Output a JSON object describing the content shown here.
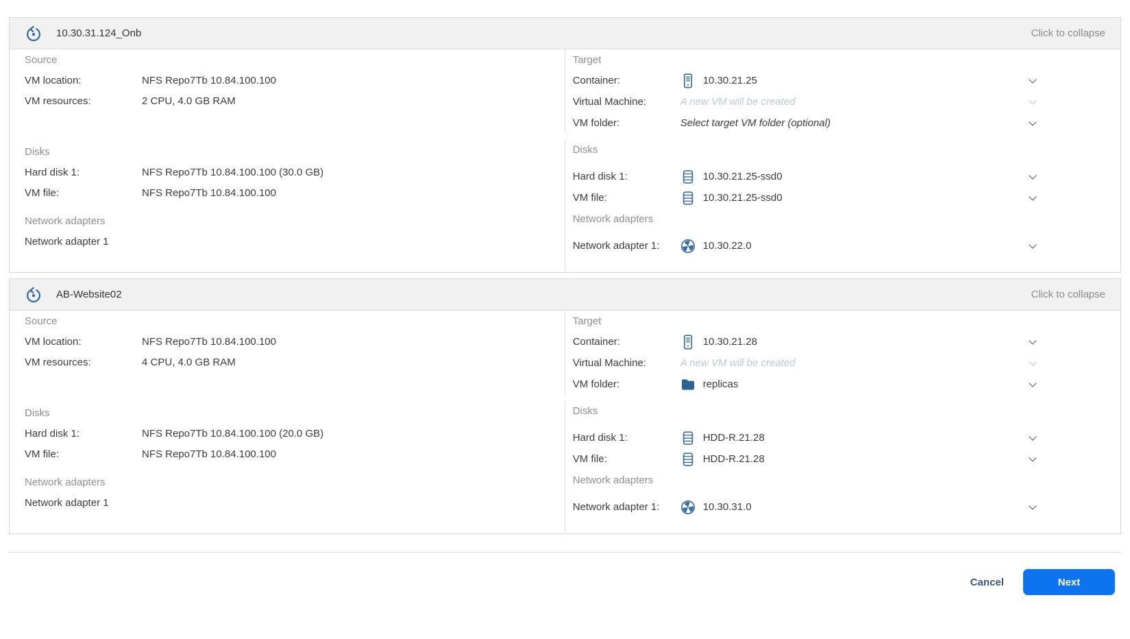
{
  "colors": {
    "accent_blue": "#0e73ee",
    "icon_blue": "#3a6d9e",
    "folder_blue": "#2d6496",
    "link_blue": "#33567d",
    "muted_text": "#8f8f8f",
    "placeholder_text": "#bcc8d4",
    "panel_header_bg": "#f1f1f1",
    "panel_border": "#d8d8d8"
  },
  "footer": {
    "cancel_label": "Cancel",
    "next_label": "Next"
  },
  "panels": [
    {
      "title": "10.30.31.124_Onb",
      "collapse_label": "Click to collapse",
      "source": {
        "heading": "Source",
        "vm_location_label": "VM location:",
        "vm_location_value": "NFS Repo7Tb 10.84.100.100",
        "vm_resources_label": "VM resources:",
        "vm_resources_value": "2 CPU, 4.0 GB RAM",
        "disks_heading": "Disks",
        "hard_disk_label": "Hard disk 1:",
        "hard_disk_value": "NFS Repo7Tb 10.84.100.100 (30.0 GB)",
        "vm_file_label": "VM file:",
        "vm_file_value": "NFS Repo7Tb 10.84.100.100",
        "network_heading": "Network adapters",
        "network_adapter_label": "Network adapter 1"
      },
      "target": {
        "heading": "Target",
        "container_label": "Container:",
        "container_value": "10.30.21.25",
        "vm_label": "Virtual Machine:",
        "vm_placeholder": "A new VM will be created",
        "vm_folder_label": "VM folder:",
        "vm_folder_value": "Select target VM folder (optional)",
        "disks_heading": "Disks",
        "hard_disk_label": "Hard disk 1:",
        "hard_disk_value": "10.30.21.25-ssd0",
        "vm_file_label": "VM file:",
        "vm_file_value": "10.30.21.25-ssd0",
        "network_heading": "Network adapters",
        "network_adapter_label": "Network adapter 1:",
        "network_adapter_value": "10.30.22.0"
      }
    },
    {
      "title": "AB-Website02",
      "collapse_label": "Click to collapse",
      "source": {
        "heading": "Source",
        "vm_location_label": "VM location:",
        "vm_location_value": "NFS Repo7Tb 10.84.100.100",
        "vm_resources_label": "VM resources:",
        "vm_resources_value": "4 CPU, 4.0 GB RAM",
        "disks_heading": "Disks",
        "hard_disk_label": "Hard disk 1:",
        "hard_disk_value": "NFS Repo7Tb 10.84.100.100 (20.0 GB)",
        "vm_file_label": "VM file:",
        "vm_file_value": "NFS Repo7Tb 10.84.100.100",
        "network_heading": "Network adapters",
        "network_adapter_label": "Network adapter 1"
      },
      "target": {
        "heading": "Target",
        "container_label": "Container:",
        "container_value": "10.30.21.28",
        "vm_label": "Virtual Machine:",
        "vm_placeholder": "A new VM will be created",
        "vm_folder_label": "VM folder:",
        "vm_folder_value": "replicas",
        "disks_heading": "Disks",
        "hard_disk_label": "Hard disk 1:",
        "hard_disk_value": "HDD-R.21.28",
        "vm_file_label": "VM file:",
        "vm_file_value": "HDD-R.21.28",
        "network_heading": "Network adapters",
        "network_adapter_label": "Network adapter 1:",
        "network_adapter_value": "10.30.31.0"
      }
    }
  ]
}
